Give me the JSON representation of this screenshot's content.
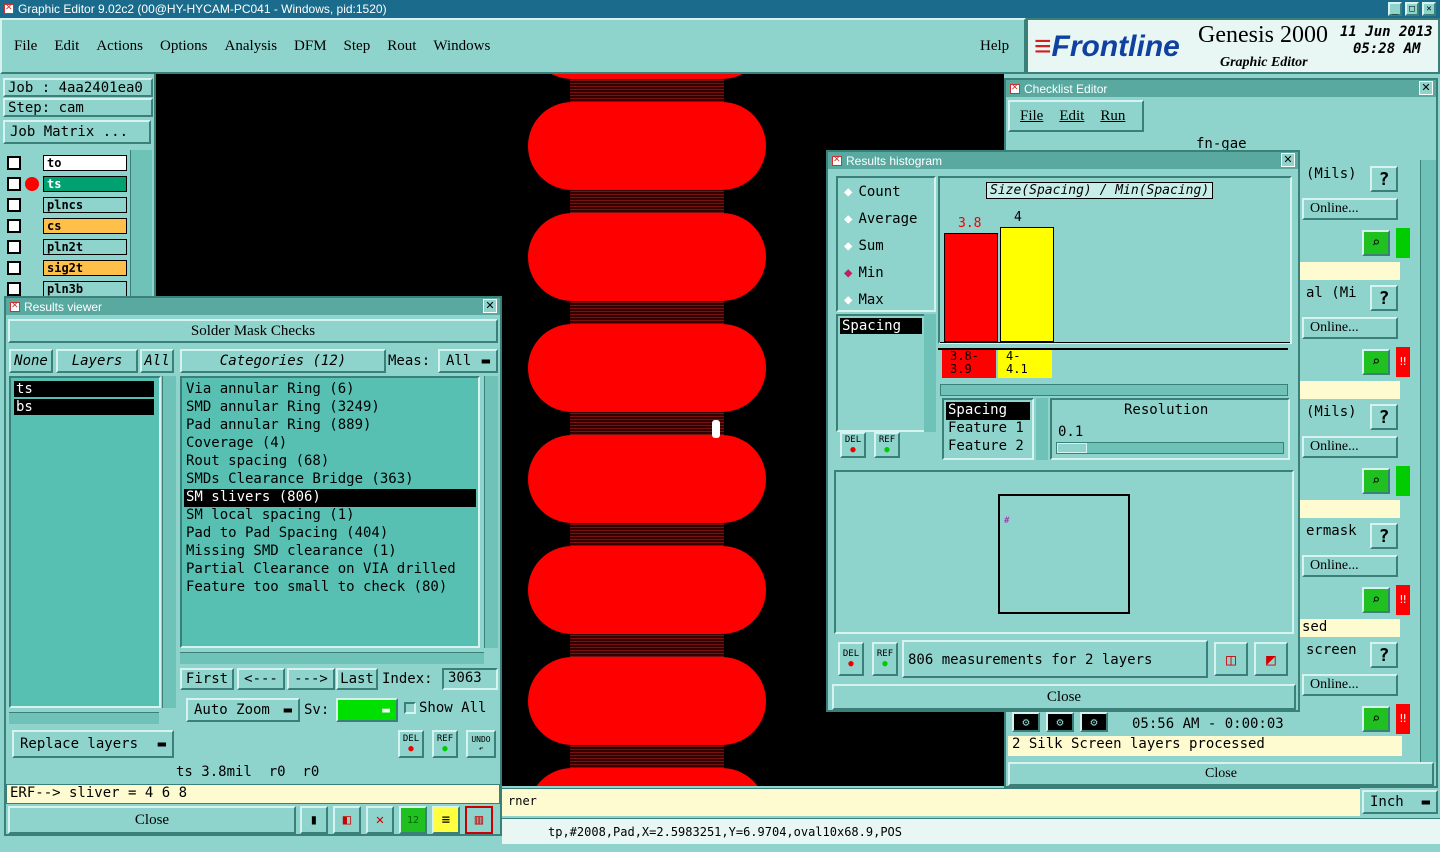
{
  "window_title": "Graphic Editor 9.02c2 (00@HY-HYCAM-PC041 - Windows, pid:1520)",
  "menu": [
    "File",
    "Edit",
    "Actions",
    "Options",
    "Analysis",
    "DFM",
    "Step",
    "Rout",
    "Windows"
  ],
  "help_label": "Help",
  "brand": {
    "logo": "Frontline",
    "product": "Genesis 2000",
    "subtitle": "Graphic Editor",
    "date": "11 Jun 2013",
    "time": "05:28 AM"
  },
  "job": {
    "job_label": "Job : 4aa2401ea0",
    "step_label": "Step: cam",
    "matrix_button": "Job Matrix ..."
  },
  "layers": [
    {
      "name": "to",
      "color": "#ffffff"
    },
    {
      "name": "ts",
      "color": "#00a070"
    },
    {
      "name": "plncs",
      "color": "#8fd4cc"
    },
    {
      "name": "cs",
      "color": "#ffc04a"
    },
    {
      "name": "pln2t",
      "color": "#8fd4cc"
    },
    {
      "name": "sig2t",
      "color": "#ffc04a"
    },
    {
      "name": "pln3b",
      "color": "#8fd4cc"
    }
  ],
  "results_viewer": {
    "title": "Results viewer",
    "header": "Solder Mask Checks",
    "none_label": "None",
    "layers_label": "Layers",
    "all_label": "All",
    "categories_label": "Categories (12)",
    "meas_label": "Meas:",
    "meas_value": "All",
    "layer_items": [
      "ts",
      "bs"
    ],
    "categories": [
      "Via annular Ring (6)",
      "SMD annular Ring (3249)",
      "Pad annular Ring (889)",
      "Coverage (4)",
      "Rout spacing (68)",
      "SMDs Clearance Bridge (363)",
      "SM slivers (806)",
      "SM local spacing (1)",
      "Pad to Pad Spacing (404)",
      "Missing SMD clearance (1)",
      "Partial Clearance on VIA drilled",
      "Feature too small to check (80)"
    ],
    "selected_category": "SM slivers (806)",
    "first": "First",
    "prev": "<---",
    "next": "--->",
    "last": "Last",
    "index_label": "Index:",
    "index_value": "3063",
    "replace_layers": "Replace layers",
    "auto_zoom": "Auto Zoom",
    "sv_label": "Sv:",
    "show_all": "Show All",
    "status": "ts 3.8mil  r0  r0",
    "erf": "ERF--> sliver = 4 6 8",
    "close": "Close",
    "del": "DEL",
    "ref": "REF",
    "undo": "UNDO"
  },
  "checklist": {
    "title": "Checklist Editor",
    "menu": [
      "File",
      "Edit",
      "Run"
    ],
    "name": "fn-gae",
    "rows": [
      {
        "label": "(Mils)",
        "online": "Online...",
        "status_color": "#00cc00"
      },
      {
        "label": "al (Mi",
        "online": "Online...",
        "status_color": "#ff0000"
      },
      {
        "label": "(Mils)",
        "online": "Online...",
        "status_color": "#00cc00"
      },
      {
        "label": "ermask",
        "online": "Online...",
        "status_color": "#ff0000",
        "note": "sed"
      },
      {
        "label": "screen",
        "online": "Online...",
        "status_color": "#ff0000"
      }
    ],
    "last_time": "05:56 AM - 0:00:03",
    "last_msg": "2 Silk Screen layers processed",
    "close": "Close",
    "help": "?"
  },
  "histogram": {
    "title": "Results histogram",
    "modes": [
      "Count",
      "Average",
      "Sum",
      "Min",
      "Max"
    ],
    "selected_mode": "Min",
    "chart_title": "Size(Spacing) / Min(Spacing)",
    "bars": [
      {
        "value": 3.8,
        "label": "3.8",
        "range": "3.8-\n3.9",
        "color": "#ff0000"
      },
      {
        "value": 4,
        "label": "4",
        "range": "4-\n4.1",
        "color": "#ffff00"
      }
    ],
    "attr_list": [
      "Spacing"
    ],
    "fields": [
      "Spacing",
      "Feature 1",
      "Feature 2"
    ],
    "resolution_label": "Resolution",
    "resolution_value": "0.1",
    "summary": "806 measurements for 2 layers",
    "close": "Close",
    "del": "DEL",
    "ref": "REF"
  },
  "bottom": {
    "corner_text": "rner",
    "unit": "Inch",
    "coords": "tp,#2008,Pad,X=2.5983251,Y=6.9704,oval10x68.9,POS"
  },
  "colors": {
    "pad": "#ff0000",
    "canvas": "#000000",
    "panel": "#8fd4cc"
  }
}
